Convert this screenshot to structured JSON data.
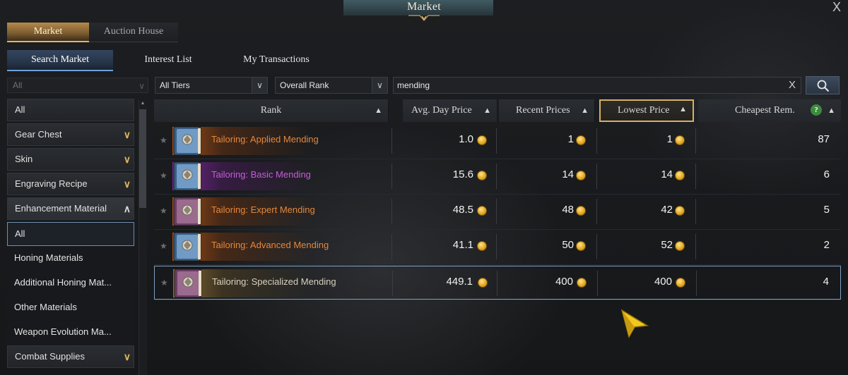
{
  "window": {
    "title": "Market",
    "close_glyph": "X"
  },
  "top_tabs": [
    {
      "label": "Market",
      "active": true
    },
    {
      "label": "Auction House",
      "active": false
    }
  ],
  "sub_tabs": [
    {
      "label": "Search Market",
      "active": true
    },
    {
      "label": "Interest List",
      "active": false
    },
    {
      "label": "My Transactions",
      "active": false
    }
  ],
  "filters": {
    "sidebar_filter": "All",
    "tier": "All Tiers",
    "rank": "Overall Rank",
    "search_value": "mending",
    "clear_glyph": "X"
  },
  "sidebar": {
    "categories": [
      {
        "label": "All",
        "expandable": false
      },
      {
        "label": "Gear Chest",
        "expandable": true
      },
      {
        "label": "Skin",
        "expandable": true
      },
      {
        "label": "Engraving Recipe",
        "expandable": true
      },
      {
        "label": "Enhancement Material",
        "expandable": true,
        "expanded": true
      },
      {
        "label": "Combat Supplies",
        "expandable": true
      }
    ],
    "subitems": [
      {
        "label": "All",
        "selected": true
      },
      {
        "label": "Honing Materials"
      },
      {
        "label": "Additional Honing Mat..."
      },
      {
        "label": "Other Materials"
      },
      {
        "label": "Weapon Evolution Ma..."
      }
    ]
  },
  "table": {
    "columns": [
      {
        "label": "Rank",
        "sort": "▲"
      },
      {
        "label": "Avg. Day Price",
        "sort": "▲"
      },
      {
        "label": "Recent Prices",
        "sort": "▲"
      },
      {
        "label": "Lowest Price",
        "sort": "▲",
        "highlighted": true
      },
      {
        "label": "Cheapest Rem.",
        "sort": "▲",
        "help": "?"
      }
    ],
    "rows": [
      {
        "name": "Tailoring: Applied Mending",
        "grade": "legendary",
        "name_color": "#e5873a",
        "avg": "1.0",
        "recent": "1",
        "lowest": "1",
        "remaining": "87",
        "icon": "blue-book-icon"
      },
      {
        "name": "Tailoring: Basic Mending",
        "grade": "epic",
        "name_color": "#c35ed6",
        "avg": "15.6",
        "recent": "14",
        "lowest": "14",
        "remaining": "6",
        "icon": "blue-book-icon"
      },
      {
        "name": "Tailoring: Expert Mending",
        "grade": "legendary",
        "name_color": "#e5873a",
        "avg": "48.5",
        "recent": "48",
        "lowest": "42",
        "remaining": "5",
        "icon": "purple-book-icon"
      },
      {
        "name": "Tailoring: Advanced Mending",
        "grade": "legendary",
        "name_color": "#e5873a",
        "avg": "41.1",
        "recent": "50",
        "lowest": "52",
        "remaining": "2",
        "icon": "blue-book-icon"
      },
      {
        "name": "Tailoring: Specialized Mending",
        "grade": "relic",
        "name_color": "#d8d0c0",
        "avg": "449.1",
        "recent": "400",
        "lowest": "400",
        "remaining": "4",
        "icon": "purple-book-icon",
        "selected": true
      }
    ]
  },
  "colors": {
    "accent_gold": "#e1b26c",
    "accent_blue": "#6ea1d8",
    "legendary": "#e5873a",
    "epic": "#c35ed6"
  }
}
